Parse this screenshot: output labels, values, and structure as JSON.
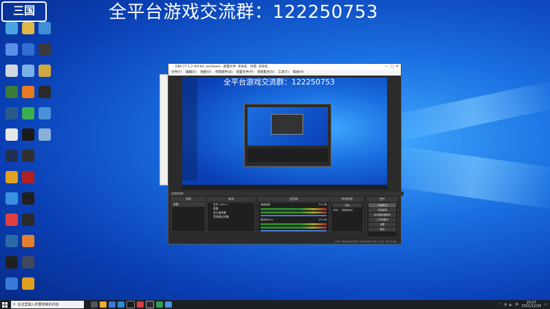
{
  "banner": {
    "text": "全平台游戏交流群：122250753"
  },
  "logo": {
    "text": "三国"
  },
  "desktop_icons": [
    {
      "col": 0,
      "row": 0,
      "color": "#4aa3e0"
    },
    {
      "col": 1,
      "row": 0,
      "color": "#e0b84a"
    },
    {
      "col": 2,
      "row": 0,
      "color": "#3f8fd8"
    },
    {
      "col": 0,
      "row": 1,
      "color": "#5a8fe8"
    },
    {
      "col": 1,
      "row": 1,
      "color": "#2f6fd0"
    },
    {
      "col": 2,
      "row": 1,
      "color": "#3a3a3a"
    },
    {
      "col": 0,
      "row": 2,
      "color": "#cfd8e0"
    },
    {
      "col": 1,
      "row": 2,
      "color": "#7ab0e8"
    },
    {
      "col": 2,
      "row": 2,
      "color": "#d0a840"
    },
    {
      "col": 0,
      "row": 3,
      "color": "#3a7a3a"
    },
    {
      "col": 1,
      "row": 3,
      "color": "#e87a20"
    },
    {
      "col": 2,
      "row": 3,
      "color": "#2a2a2a"
    },
    {
      "col": 0,
      "row": 4,
      "color": "#2a5a8a"
    },
    {
      "col": 1,
      "row": 4,
      "color": "#38b050"
    },
    {
      "col": 2,
      "row": 4,
      "color": "#4a90d8"
    },
    {
      "col": 0,
      "row": 5,
      "color": "#e8e8e8"
    },
    {
      "col": 1,
      "row": 5,
      "color": "#1a1a1a"
    },
    {
      "col": 2,
      "row": 5,
      "color": "#8ab0d8"
    },
    {
      "col": 0,
      "row": 6,
      "color": "#203050"
    },
    {
      "col": 1,
      "row": 6,
      "color": "#303030"
    },
    {
      "col": 0,
      "row": 7,
      "color": "#e0a020"
    },
    {
      "col": 1,
      "row": 7,
      "color": "#b02020"
    },
    {
      "col": 0,
      "row": 8,
      "color": "#3a90e0"
    },
    {
      "col": 1,
      "row": 8,
      "color": "#202020"
    },
    {
      "col": 0,
      "row": 9,
      "color": "#e04040"
    },
    {
      "col": 1,
      "row": 9,
      "color": "#2a2a2a"
    },
    {
      "col": 0,
      "row": 10,
      "color": "#2a6aa8"
    },
    {
      "col": 1,
      "row": 10,
      "color": "#e08030"
    },
    {
      "col": 0,
      "row": 11,
      "color": "#202020"
    },
    {
      "col": 1,
      "row": 11,
      "color": "#404860"
    },
    {
      "col": 0,
      "row": 12,
      "color": "#3a7ad8"
    },
    {
      "col": 1,
      "row": 12,
      "color": "#e0a020"
    }
  ],
  "taskbar": {
    "search_placeholder": "在这里输入你要搜索的内容",
    "time": "20:07",
    "date": "2021/12/26"
  },
  "obs": {
    "title": "OBS 27.1.3 (64-bit, windows) - 配置文件: 未命名 - 场景: 未命名",
    "menu": [
      "文件(F)",
      "编辑(E)",
      "视图(V)",
      "停靠部件(D)",
      "配置文件(P)",
      "场景集合(S)",
      "工具(T)",
      "帮助(H)"
    ],
    "preview_title": "全平台游戏交流群：122250753",
    "docks": {
      "scenes": "场景",
      "sources": "来源",
      "mixer": "混音器",
      "transitions": "转场特效",
      "controls": "控件"
    },
    "scene_item": "场景",
    "sources": [
      "文本 (GDI+)",
      "图像",
      "显示器采集",
      "音频输出采集"
    ],
    "mixer": [
      {
        "name": "桌面音频",
        "db": "0.0 dB"
      },
      {
        "name": "麦克风/Aux",
        "db": "0.0 dB"
      }
    ],
    "transition": {
      "type": "淡出",
      "duration_label": "时长",
      "duration": "300 ms"
    },
    "controls": [
      "开始推流",
      "开始录制",
      "启动虚拟摄像机",
      "工作室模式",
      "设置",
      "退出"
    ],
    "no_source": "未选择来源",
    "status": "LIVE: 00:00:00    REC: 00:00:00    CPU: 3.4%, 30.00 fps"
  }
}
